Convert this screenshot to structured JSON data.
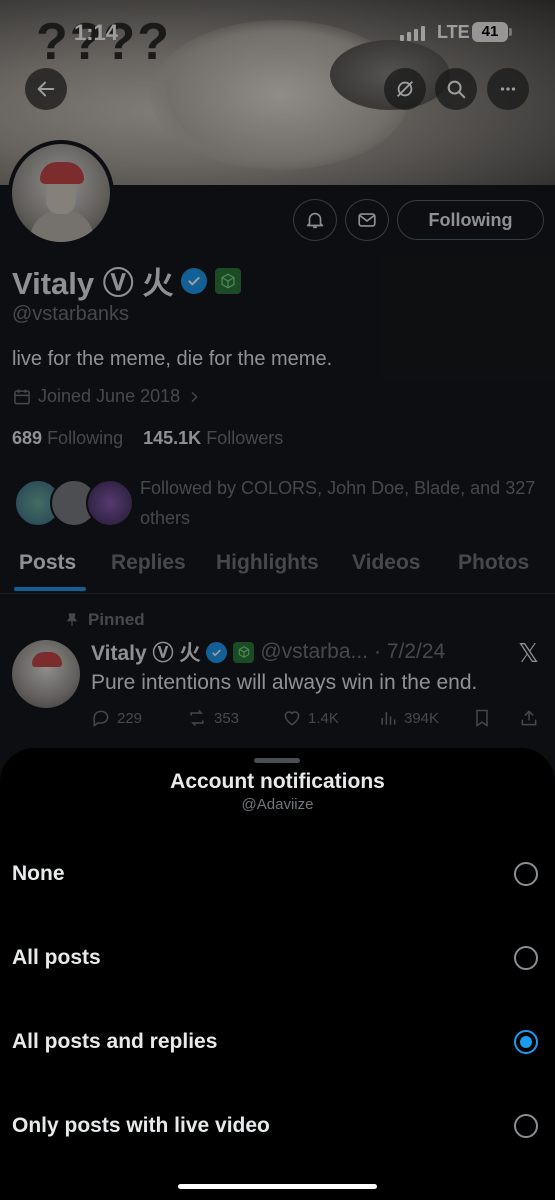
{
  "status_bar": {
    "time": "1:14",
    "network": "LTE",
    "battery": "41"
  },
  "banner": {
    "overlay_text": "????"
  },
  "profile": {
    "following_button": "Following",
    "name": "Vitaly Ⓥ 火",
    "handle": "@vstarbanks",
    "bio": "live for the meme, die for the meme.",
    "joined": "Joined June 2018",
    "following_count": "689",
    "following_label": "Following",
    "followers_count": "145.1K",
    "followers_label": "Followers",
    "followed_by": "Followed by COLORS, John Doe, Blade, and 327 others"
  },
  "tabs": [
    {
      "label": "Posts",
      "active": true
    },
    {
      "label": "Replies"
    },
    {
      "label": "Highlights"
    },
    {
      "label": "Videos"
    },
    {
      "label": "Photos"
    }
  ],
  "pinned_post": {
    "pinned_label": "Pinned",
    "author_name": "Vitaly Ⓥ 火",
    "author_handle": "@vstarba...",
    "date": "· 7/2/24",
    "text": "Pure intentions will always win in the end.",
    "replies": "229",
    "reposts": "353",
    "likes": "1.4K",
    "views": "394K"
  },
  "sheet": {
    "title": "Account notifications",
    "subtitle": "@Adaviize",
    "options": [
      {
        "label": "None",
        "selected": false
      },
      {
        "label": "All posts",
        "selected": false
      },
      {
        "label": "All posts and replies",
        "selected": true
      },
      {
        "label": "Only posts with live video",
        "selected": false
      }
    ]
  },
  "colors": {
    "accent": "#1d9bf0",
    "background": "#15181c",
    "sheet": "#000000"
  }
}
